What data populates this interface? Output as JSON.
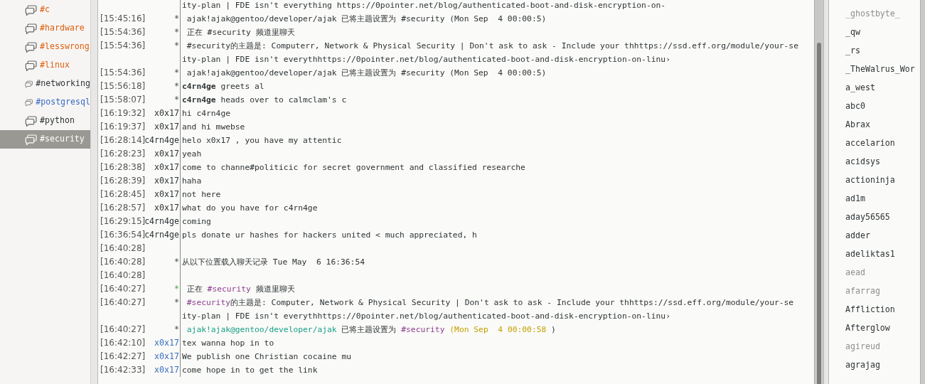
{
  "channels": [
    {
      "name": "#c",
      "color": "#e0600e",
      "selected": false
    },
    {
      "name": "#hardware",
      "color": "#e0600e",
      "selected": false
    },
    {
      "name": "#lesswrong",
      "color": "#e0600e",
      "selected": false
    },
    {
      "name": "#linux",
      "color": "#e0600e",
      "selected": false
    },
    {
      "name": "#networking",
      "color": "#2e3436",
      "selected": false
    },
    {
      "name": "#postgresql",
      "color": "#3b6bc5",
      "selected": false
    },
    {
      "name": "#python",
      "color": "#2e3436",
      "selected": false
    },
    {
      "name": "#security",
      "color": "#ffffff",
      "selected": true
    }
  ],
  "messages": [
    {
      "kind": "continuation",
      "parts": [
        {
          "kind": "plain",
          "text": "ity-plan | FDE isn't everything https://0pointer.net/blog/authenticated-boot-and-disk-encryption-on-"
        }
      ]
    },
    {
      "kind": "event",
      "time": "[15:45:16]",
      "nick": "*",
      "parts": [
        {
          "kind": "plain",
          "text": " ajak!ajak@gentoo/developer/ajak 已将主题设置为 #security (Mon Sep  4 00:00:5)"
        }
      ]
    },
    {
      "kind": "event",
      "time": "[15:54:36]",
      "nick": "*",
      "parts": [
        {
          "kind": "plain",
          "text": " 正在 #security 频道里聊天"
        }
      ]
    },
    {
      "kind": "event",
      "time": "[15:54:36]",
      "nick": "*",
      "parts": [
        {
          "kind": "plain",
          "text": " #security的主题是: Computerr, Network & Physical Security | Don't ask to ask - Include your thhttps://ssd.eff.org/module/your-se"
        }
      ]
    },
    {
      "kind": "continuation",
      "parts": [
        {
          "kind": "plain",
          "text": "ity-plan | FDE isn't everythhttps://0pointer.net/blog/authenticated-boot-and-disk-encryption-on-linu›"
        }
      ]
    },
    {
      "kind": "event",
      "time": "[15:54:36]",
      "nick": "*",
      "parts": [
        {
          "kind": "plain",
          "text": " ajak!ajak@gentoo/developer/ajak 已将主题设置为 #security (Mon Sep  4 00:00:5)"
        }
      ]
    },
    {
      "kind": "event",
      "time": "[15:56:18]",
      "nick": "*",
      "parts": [
        {
          "kind": "bold",
          "text": "c4rn4ge"
        },
        {
          "kind": "plain",
          "text": " greets al"
        }
      ]
    },
    {
      "kind": "event",
      "time": "[15:58:07]",
      "nick": "*",
      "parts": [
        {
          "kind": "bold",
          "text": "c4rn4ge"
        },
        {
          "kind": "plain",
          "text": " heads over to calmclam's c"
        }
      ]
    },
    {
      "kind": "message",
      "time": "[16:19:32]",
      "nick": "x0x17",
      "color": "#2e3436",
      "parts": [
        {
          "kind": "plain",
          "text": "hi c4rn4ge"
        }
      ]
    },
    {
      "kind": "message",
      "time": "[16:19:37]",
      "nick": "x0x17",
      "color": "#2e3436",
      "parts": [
        {
          "kind": "plain",
          "text": "and hi mwebse"
        }
      ]
    },
    {
      "kind": "message",
      "time": "[16:28:14]",
      "nick": "c4rn4ge",
      "color": "#2e3436",
      "parts": [
        {
          "kind": "plain",
          "text": "helo x0x17 , you have my attentic"
        }
      ]
    },
    {
      "kind": "message",
      "time": "[16:28:23]",
      "nick": "x0x17",
      "color": "#2e3436",
      "parts": [
        {
          "kind": "plain",
          "text": "yeah"
        }
      ]
    },
    {
      "kind": "message",
      "time": "[16:28:38]",
      "nick": "x0x17",
      "color": "#2e3436",
      "parts": [
        {
          "kind": "plain",
          "text": "come to channe#politicic for secret government and classified researche"
        }
      ]
    },
    {
      "kind": "message",
      "time": "[16:28:39]",
      "nick": "x0x17",
      "color": "#2e3436",
      "parts": [
        {
          "kind": "plain",
          "text": "haha"
        }
      ]
    },
    {
      "kind": "message",
      "time": "[16:28:45]",
      "nick": "x0x17",
      "color": "#2e3436",
      "parts": [
        {
          "kind": "plain",
          "text": "not here"
        }
      ]
    },
    {
      "kind": "message",
      "time": "[16:28:57]",
      "nick": "x0x17",
      "color": "#2e3436",
      "parts": [
        {
          "kind": "plain",
          "text": "what do you have for c4rn4ge"
        }
      ]
    },
    {
      "kind": "message",
      "time": "[16:29:15]",
      "nick": "c4rn4ge",
      "color": "#2e3436",
      "parts": [
        {
          "kind": "plain",
          "text": "coming"
        }
      ]
    },
    {
      "kind": "message",
      "time": "[16:36:54]",
      "nick": "c4rn4ge",
      "color": "#2e3436",
      "parts": [
        {
          "kind": "plain",
          "text": "pls donate ur hashes for hackers united < much appreciated, h"
        }
      ]
    },
    {
      "kind": "blank",
      "time": "[16:40:28]"
    },
    {
      "kind": "event",
      "time": "[16:40:28]",
      "nick": "*",
      "parts": [
        {
          "kind": "plain",
          "text": "从以下位置载入聊天记录 Tue May  6 16:36:54"
        }
      ]
    },
    {
      "kind": "blank",
      "time": "[16:40:28]"
    },
    {
      "kind": "join",
      "time": "[16:40:27]",
      "nick": "*",
      "parts": [
        {
          "kind": "plain",
          "text": " 正在 "
        },
        {
          "kind": "channel",
          "text": "#security"
        },
        {
          "kind": "plain",
          "text": " 频道里聊天"
        }
      ]
    },
    {
      "kind": "event",
      "time": "[16:40:27]",
      "nick": "*",
      "parts": [
        {
          "kind": "channel",
          "text": " #security"
        },
        {
          "kind": "plain",
          "text": "的主题是: Computer, Network & Physical Security | Don't ask to ask - Include your thhttps://ssd.eff.org/module/your-se"
        }
      ]
    },
    {
      "kind": "continuation",
      "parts": [
        {
          "kind": "plain",
          "text": "ity-plan | FDE isn't everythhttps://0pointer.net/blog/authenticated-boot-and-disk-encryption-on-linu›"
        }
      ]
    },
    {
      "kind": "event",
      "time": "[16:40:27]",
      "nick": "*",
      "parts": [
        {
          "kind": "hostmask",
          "text": " ajak!ajak@gentoo/developer/ajak"
        },
        {
          "kind": "plain",
          "text": " 已将主题设置为 "
        },
        {
          "kind": "channel",
          "text": "#security"
        },
        {
          "kind": "date",
          "text": " (Mon Sep  4 00:00:58"
        },
        {
          "kind": "plain",
          "text": " )"
        }
      ]
    },
    {
      "kind": "message",
      "time": "[16:42:10]",
      "nick": "x0x17",
      "color": "#3a6fbf",
      "parts": [
        {
          "kind": "plain",
          "text": "tex wanna hop in to"
        }
      ]
    },
    {
      "kind": "message",
      "time": "[16:42:27]",
      "nick": "x0x17",
      "color": "#3a6fbf",
      "parts": [
        {
          "kind": "plain",
          "text": "We publish one Christian cocaine mu"
        }
      ]
    },
    {
      "kind": "message",
      "time": "[16:42:33]",
      "nick": "x0x17",
      "color": "#3a6fbf",
      "parts": [
        {
          "kind": "plain",
          "text": "come hope in to get the link"
        }
      ]
    }
  ],
  "users": [
    {
      "name": "_ghostbyte_",
      "away": true
    },
    {
      "name": "_qw",
      "away": false
    },
    {
      "name": "_rs",
      "away": false
    },
    {
      "name": "_TheWalrus_Wor",
      "away": false
    },
    {
      "name": "a_west",
      "away": false
    },
    {
      "name": "abc0",
      "away": false
    },
    {
      "name": "Abrax",
      "away": false
    },
    {
      "name": "accelarion",
      "away": false
    },
    {
      "name": "acidsys",
      "away": false
    },
    {
      "name": "actioninja",
      "away": false
    },
    {
      "name": "ad1m",
      "away": false
    },
    {
      "name": "aday56565",
      "away": false
    },
    {
      "name": "adder",
      "away": false
    },
    {
      "name": "adeliktas1",
      "away": false
    },
    {
      "name": "aead",
      "away": true
    },
    {
      "name": "afarrag",
      "away": true
    },
    {
      "name": "Affliction",
      "away": false
    },
    {
      "name": "Afterglow",
      "away": false
    },
    {
      "name": "agireud",
      "away": true
    },
    {
      "name": "agrajag",
      "away": false
    }
  ]
}
